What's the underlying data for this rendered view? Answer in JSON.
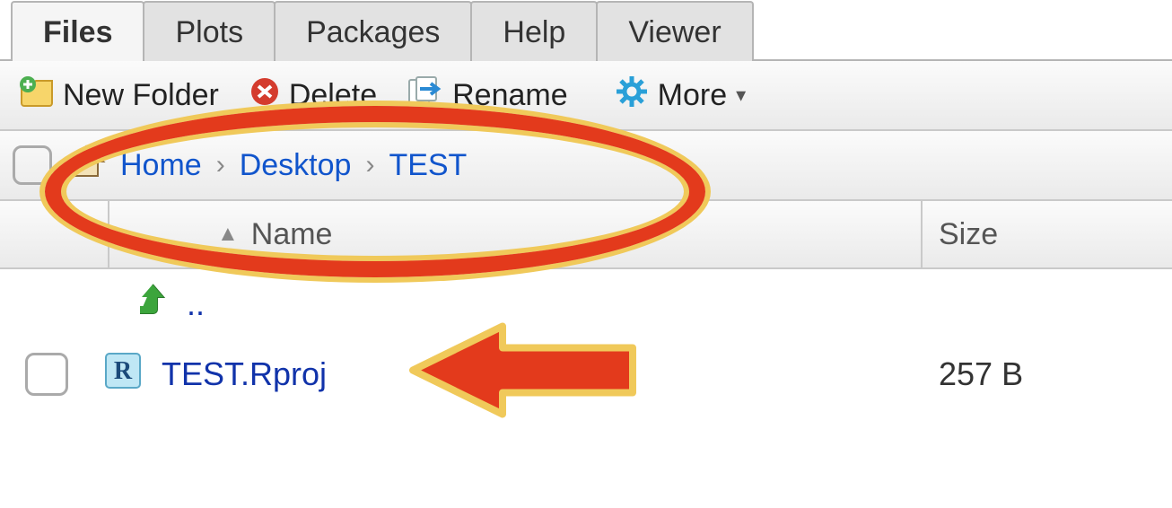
{
  "tabs": {
    "files": "Files",
    "plots": "Plots",
    "packages": "Packages",
    "help": "Help",
    "viewer": "Viewer",
    "active": "files"
  },
  "toolbar": {
    "new_folder": "New Folder",
    "delete": "Delete",
    "rename": "Rename",
    "more": "More"
  },
  "breadcrumb": {
    "home": "Home",
    "desktop": "Desktop",
    "test": "TEST"
  },
  "columns": {
    "name": "Name",
    "size": "Size"
  },
  "rows": {
    "up": "..",
    "proj": {
      "name": "TEST.Rproj",
      "size": "257 B"
    }
  }
}
